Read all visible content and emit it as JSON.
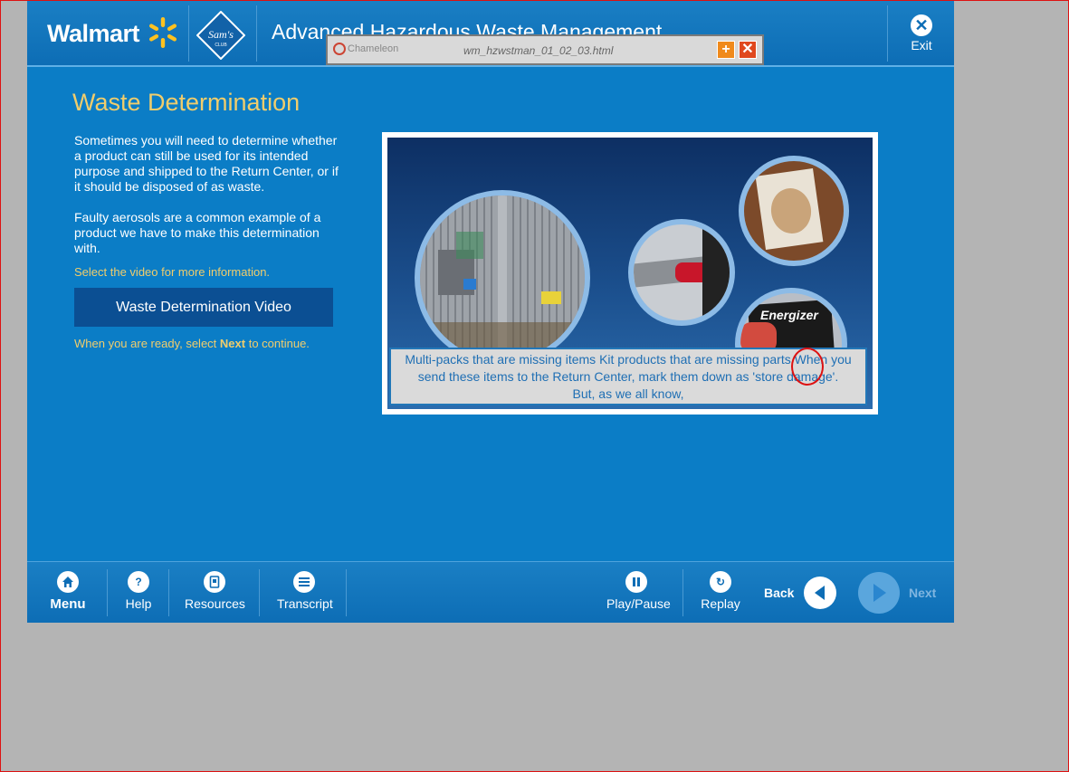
{
  "header": {
    "walmart_logo": "Walmart",
    "sams_logo_line1": "Sam's",
    "sams_logo_line2": "CLUB",
    "course_title": "Advanced Hazardous Waste Management",
    "exit_label": "Exit"
  },
  "chameleon": {
    "logo_text": "Chameleon",
    "file_name": "wm_hzwstman_01_02_03.html",
    "expand_icon": "plus-icon",
    "close_icon": "close-icon"
  },
  "content": {
    "page_title": "Waste Determination",
    "paragraph1": "Sometimes you will need to determine whether a product can still be used for its intended purpose and shipped to the Return Center, or if it should be disposed of as waste.",
    "paragraph2": "Faulty aerosols are a common example of a product we have to make this determination with.",
    "video_hint": "Select the video for more information.",
    "video_button_label": "Waste Determination Video",
    "continue_prefix": "When you are ready, select ",
    "continue_next": "Next",
    "continue_suffix": " to continue."
  },
  "video": {
    "caption_line1": "Multi-packs that are missing items Kit products that are missing parts When you",
    "caption_line2": "send these items to the Return Center, mark them down as 'store damage'.",
    "caption_line3": "But, as we all know,",
    "battery_brand": "Energizer"
  },
  "footer": {
    "menu_label": "Menu",
    "help_label": "Help",
    "resources_label": "Resources",
    "transcript_label": "Transcript",
    "playpause_label": "Play/Pause",
    "replay_label": "Replay",
    "back_label": "Back",
    "next_label": "Next"
  },
  "colors": {
    "background_blue": "#0b7dc6",
    "title_gold": "#f0cd6c",
    "button_dark_blue": "#0b4f93",
    "spark_yellow": "#ffc220"
  }
}
